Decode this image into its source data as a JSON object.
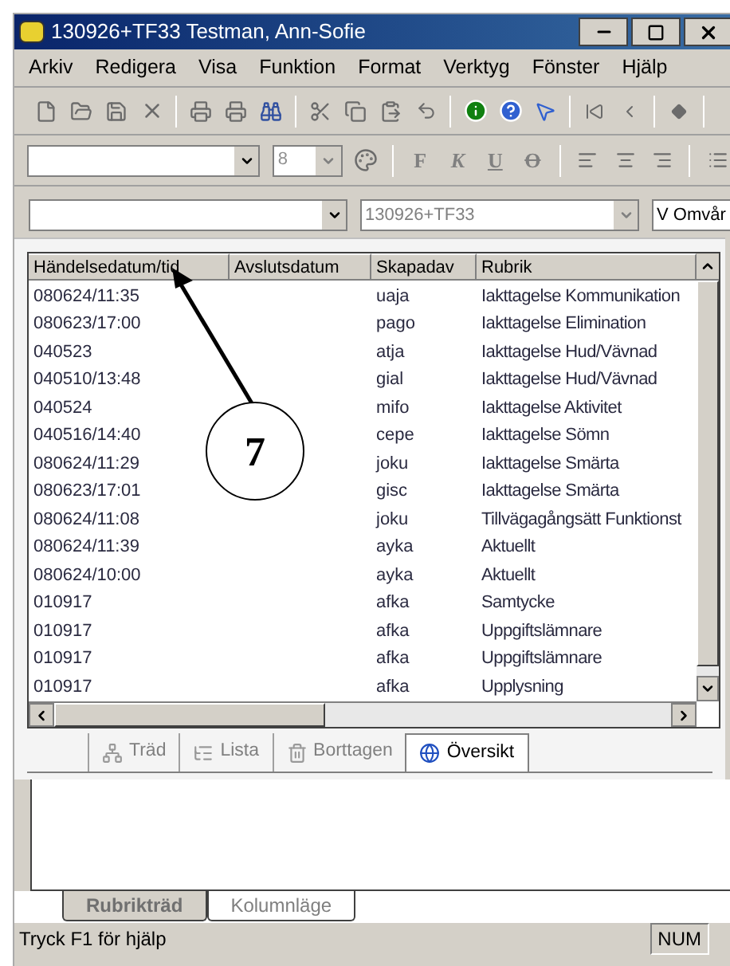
{
  "window": {
    "title": "130926+TF33 Testman, Ann-Sofie"
  },
  "menu": [
    "Arkiv",
    "Redigera",
    "Visa",
    "Funktion",
    "Format",
    "Verktyg",
    "Fönster",
    "Hjälp"
  ],
  "format_bar": {
    "font_size": "8",
    "styles": [
      {
        "label": "F",
        "kind": "bold"
      },
      {
        "label": "K",
        "kind": "italic"
      },
      {
        "label": "U",
        "kind": "underline"
      },
      {
        "label": "O",
        "kind": "strikethrough"
      }
    ]
  },
  "selectors": {
    "patient": "130926+TF33",
    "unit": "V Omvår"
  },
  "table": {
    "columns": [
      "Händelsedatum/tid",
      "Avslutsdatum",
      "Skapadav",
      "Rubrik"
    ],
    "rows": [
      {
        "date": "080624/11:35",
        "creator": "uaja",
        "heading": "Iakttagelse Kommunikation"
      },
      {
        "date": "080623/17:00",
        "creator": "pago",
        "heading": "Iakttagelse Elimination"
      },
      {
        "date": "040523",
        "creator": "atja",
        "heading": "Iakttagelse Hud/Vävnad"
      },
      {
        "date": "040510/13:48",
        "creator": "gial",
        "heading": "Iakttagelse Hud/Vävnad"
      },
      {
        "date": "040524",
        "creator": "mifo",
        "heading": "Iakttagelse Aktivitet"
      },
      {
        "date": "040516/14:40",
        "creator": "cepe",
        "heading": "Iakttagelse Sömn"
      },
      {
        "date": "080624/11:29",
        "creator": "joku",
        "heading": "Iakttagelse Smärta"
      },
      {
        "date": "080623/17:01",
        "creator": "gisc",
        "heading": "Iakttagelse Smärta"
      },
      {
        "date": "080624/11:08",
        "creator": "joku",
        "heading": "Tillvägagångsätt Funktionst"
      },
      {
        "date": "080624/11:39",
        "creator": "ayka",
        "heading": "Aktuellt"
      },
      {
        "date": "080624/10:00",
        "creator": "ayka",
        "heading": "Aktuellt"
      },
      {
        "date": "010917",
        "creator": "afka",
        "heading": "Samtycke"
      },
      {
        "date": "010917",
        "creator": "afka",
        "heading": "Uppgiftslämnare"
      },
      {
        "date": "010917",
        "creator": "afka",
        "heading": "Uppgiftslämnare"
      },
      {
        "date": "010917",
        "creator": "afka",
        "heading": "Upplysning"
      }
    ]
  },
  "view_tabs": [
    {
      "label": "Träd",
      "kind": "tree",
      "selected": false
    },
    {
      "label": "Lista",
      "kind": "list",
      "selected": false
    },
    {
      "label": "Borttagen",
      "kind": "trash",
      "selected": false
    },
    {
      "label": "Översikt",
      "kind": "globe",
      "selected": true
    }
  ],
  "bottom_tabs": [
    {
      "label": "Rubrikträd",
      "selected": true
    },
    {
      "label": "Kolumnläge",
      "selected": false
    }
  ],
  "status_bar": {
    "text": "Tryck F1 för hjälp",
    "indicator": "NUM"
  },
  "annotation": {
    "number": "7"
  }
}
